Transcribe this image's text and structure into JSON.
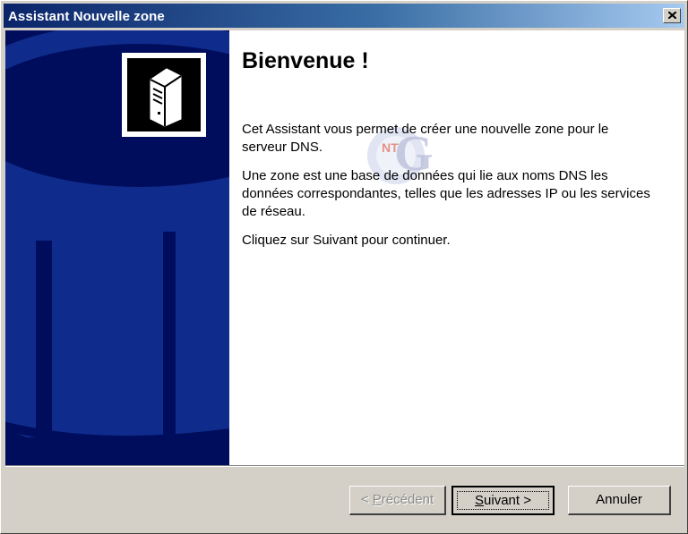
{
  "window": {
    "title": "Assistant Nouvelle zone",
    "close_glyph": "✕"
  },
  "banner": {
    "icon": "server-icon",
    "colors": {
      "background": "#000d5c",
      "cylinder": "#0f2c8c"
    }
  },
  "content": {
    "heading": "Bienvenue !",
    "paragraph1": "Cet Assistant vous permet de créer une nouvelle zone pour le serveur DNS.",
    "paragraph2": "Une zone est une base de données qui lie aux noms DNS les données correspondantes, telles que les adresses IP ou les services de réseau.",
    "paragraph3": "Cliquez sur Suivant pour continuer.",
    "watermark": {
      "letter": "G",
      "small_text": "NT"
    }
  },
  "buttons": {
    "previous": {
      "prefix": "< ",
      "accel": "P",
      "rest": "récédent",
      "enabled": false
    },
    "next": {
      "accel": "S",
      "rest": "uivant >",
      "enabled": true
    },
    "cancel": {
      "label": "Annuler",
      "enabled": true
    }
  }
}
